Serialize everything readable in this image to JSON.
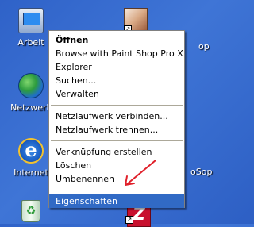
{
  "desktop": {
    "icons": [
      {
        "label": "Arbeit",
        "icon": "my-computer-icon"
      },
      {
        "label": "Netzwerk",
        "icon": "network-places-icon"
      },
      {
        "label": "Internet",
        "icon": "internet-explorer-icon"
      },
      {
        "label": "",
        "icon": "recycle-bin-icon"
      }
    ],
    "right_edge_texts": [
      "op",
      "oSop"
    ],
    "program_icons": [
      {
        "icon": "paint-shop-pro-icon"
      },
      {
        "icon": "filezilla-icon",
        "glyph": "Z"
      }
    ]
  },
  "context_menu": {
    "items": [
      {
        "label": "Öffnen",
        "bold": true
      },
      {
        "label": "Browse with Paint Shop Pro X"
      },
      {
        "label": "Explorer"
      },
      {
        "label": "Suchen..."
      },
      {
        "label": "Verwalten"
      },
      {
        "separator": true
      },
      {
        "label": "Netzlaufwerk verbinden..."
      },
      {
        "label": "Netzlaufwerk trennen..."
      },
      {
        "separator": true
      },
      {
        "label": "Verknüpfung erstellen"
      },
      {
        "label": "Löschen"
      },
      {
        "label": "Umbenennen"
      },
      {
        "separator": true
      },
      {
        "label": "Eigenschaften",
        "selected": true
      }
    ]
  },
  "colors": {
    "desktop_blue": "#3a6ea5",
    "menu_highlight": "#316ac5",
    "annotation_arrow": "#e0202a"
  }
}
